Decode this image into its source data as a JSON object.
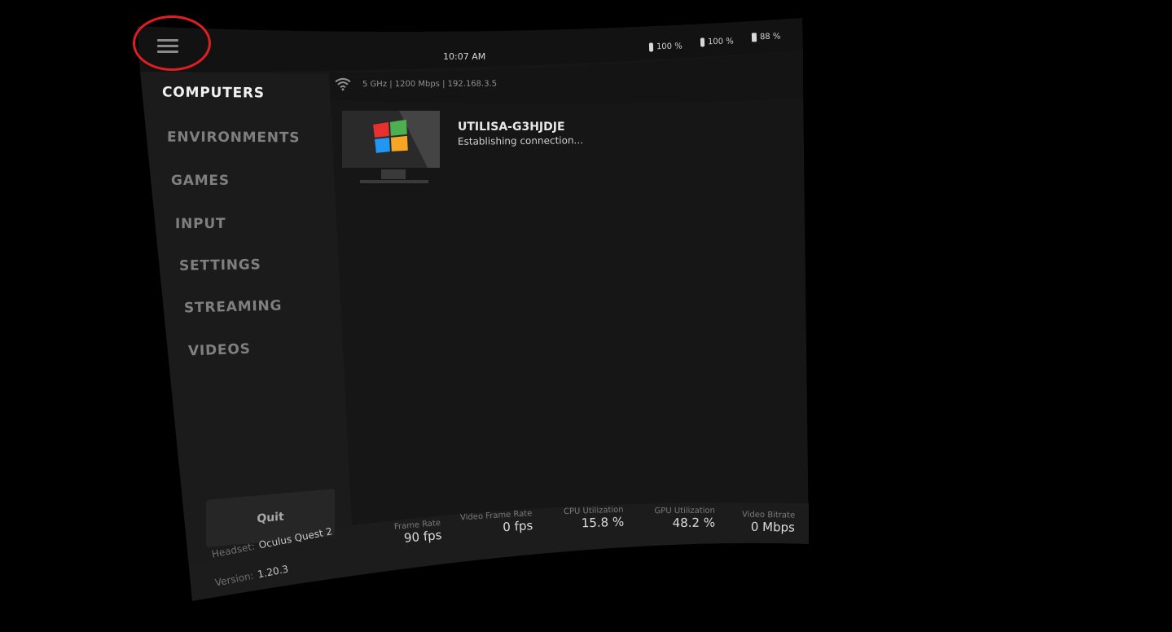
{
  "topbar": {
    "time": "10:07 AM",
    "batteries": [
      {
        "icon": "controller-battery-icon",
        "value": "100 %"
      },
      {
        "icon": "controller-battery-icon",
        "value": "100 %"
      },
      {
        "icon": "headset-battery-icon",
        "value": "88 %"
      }
    ]
  },
  "network": {
    "icon": "wifi-icon",
    "text": "5 GHz | 1200 Mbps | 192.168.3.5"
  },
  "sidebar": {
    "items": [
      {
        "label": "COMPUTERS",
        "active": true
      },
      {
        "label": "ENVIRONMENTS",
        "active": false
      },
      {
        "label": "GAMES",
        "active": false
      },
      {
        "label": "INPUT",
        "active": false
      },
      {
        "label": "SETTINGS",
        "active": false
      },
      {
        "label": "STREAMING",
        "active": false
      },
      {
        "label": "VIDEOS",
        "active": false
      }
    ],
    "quit_label": "Quit",
    "headset_label": "Headset:",
    "headset_value": "Oculus Quest 2",
    "version_label": "Version:",
    "version_value": "1.20.3"
  },
  "computer": {
    "name": "UTILISA-G3HJDJE",
    "status": "Establishing connection..."
  },
  "stats": [
    {
      "label": "Frame Rate",
      "value": "90 fps"
    },
    {
      "label": "Video Frame Rate",
      "value": "0 fps"
    },
    {
      "label": "CPU Utilization",
      "value": "15.8 %"
    },
    {
      "label": "GPU Utilization",
      "value": "48.2 %"
    },
    {
      "label": "Video Bitrate",
      "value": "0 Mbps"
    }
  ],
  "colors": {
    "background": "#000000",
    "panel": "#161616",
    "sidebar": "#1a1a1a",
    "highlight_ring": "#e01e22",
    "windows_red": "#e8312f",
    "windows_green": "#4caf50",
    "windows_blue": "#2196f3",
    "windows_yellow": "#f5a623"
  }
}
